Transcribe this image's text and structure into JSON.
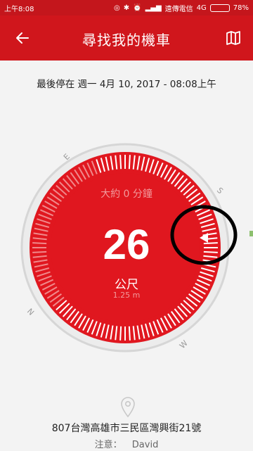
{
  "status_bar": {
    "time": "上午8:08",
    "carrier": "遠傳電信",
    "network": "4G",
    "battery": "78%"
  },
  "header": {
    "title": "尋找我的機車",
    "back_icon": "arrow-left-icon",
    "map_icon": "map-icon"
  },
  "parked_info": {
    "text": "最後停在 週一 4月 10, 2017 - 08:08上午"
  },
  "compass": {
    "hint": "大約 0 分鐘",
    "distance": "26",
    "unit": "公尺",
    "distance_sub": "1.25 m",
    "cardinals": [
      "E",
      "S",
      "W",
      "N"
    ],
    "heading_percent": 0.25,
    "accent": "#e0171f",
    "ring": "#d6d6d6"
  },
  "location": {
    "pin_icon": "location-pin-icon",
    "address": "807台灣高雄市三民區灣興街21號",
    "note_label": "注意：",
    "note_value": "David"
  }
}
